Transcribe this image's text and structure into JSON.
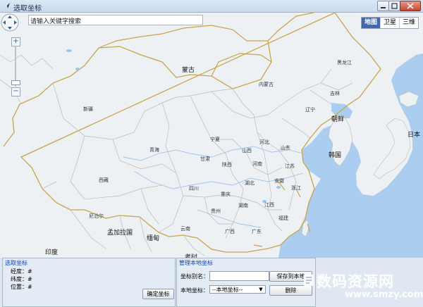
{
  "window": {
    "title": "选取坐标"
  },
  "map": {
    "search_placeholder": "请输入关键字搜索",
    "zoom_in": "+",
    "zoom_out": "−",
    "map_types": [
      "地图",
      "卫星",
      "三维"
    ],
    "labels": {
      "mongolia": "蒙古",
      "xinjiang": "新疆",
      "neimenggu": "内蒙古",
      "heilongjiang": "黑龙江",
      "jilin": "吉林",
      "liaoning": "辽宁",
      "north_korea": "朝鲜",
      "south_korea": "韩国",
      "japan": "日本",
      "qinghai": "青海",
      "gansu": "甘肃",
      "ningxia": "宁夏",
      "shaanxi": "陕西",
      "shanxi": "山西",
      "hebei": "河北",
      "shandong": "山东",
      "henan": "河南",
      "jiangsu": "江苏",
      "anhui": "安徽",
      "hubei": "湖北",
      "zhejiang": "浙江",
      "xizang": "西藏",
      "sichuan": "四川",
      "chongqing": "重庆",
      "hunan": "湖南",
      "jiangxi": "江西",
      "fujian": "福建",
      "guizhou": "贵州",
      "yunnan": "云南",
      "guangxi": "广西",
      "guangdong": "广东",
      "nepal": "尼泊尔",
      "bangladesh": "孟加拉国",
      "myanmar": "缅甸",
      "india": "印度",
      "laos": "老挝"
    }
  },
  "select_panel": {
    "title": "选取坐标",
    "longitude_label": "经度：",
    "longitude_value": "#",
    "latitude_label": "纬度：",
    "latitude_value": "#",
    "position_label": "位置：",
    "position_value": "#",
    "confirm_button": "确定坐标"
  },
  "manage_panel": {
    "title": "管理本地坐标",
    "alias_label": "坐标别名：",
    "alias_value": "",
    "save_button": "保存到本地",
    "local_label": "本地坐标：",
    "local_selected": "--本地坐标--",
    "delete_button": "删除"
  },
  "watermark": {
    "main": "数码资源网",
    "url": "www.smzy.com"
  },
  "colors": {
    "ocean": "#abcdef",
    "land": "#eef1f3",
    "border_major": "#c9a34b",
    "border_minor": "#b7bcc2",
    "river": "#9ec4ea",
    "accent": "#1545a6"
  }
}
